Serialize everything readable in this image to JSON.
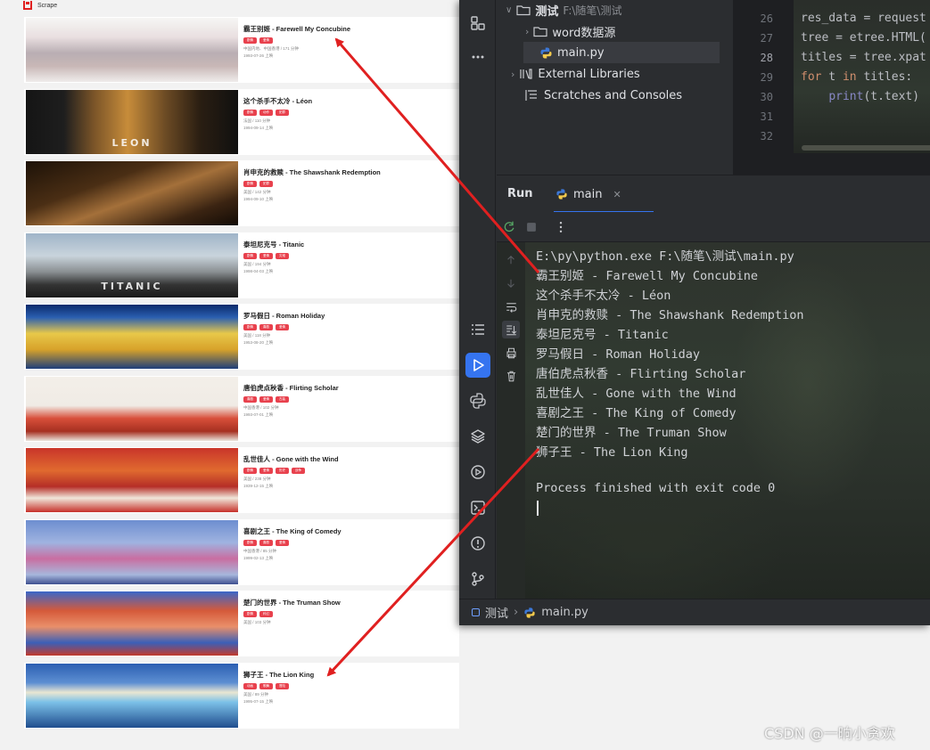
{
  "site": {
    "brand": "Scrape"
  },
  "movies": [
    {
      "title": "霸王别姬 - Farewell My Concubine",
      "poster_text": "",
      "tags": [
        "剧情",
        "爱情"
      ],
      "meta": "中国内地、中国香港 / 171 分钟",
      "date": "1993-07-26 上映",
      "poster_icon": "poster-farewell-my-concubine"
    },
    {
      "title": "这个杀手不太冷 - Léon",
      "poster_text": "LEON",
      "tags": [
        "剧情",
        "动作",
        "犯罪"
      ],
      "meta": "法国 / 110 分钟",
      "date": "1994-09-14 上映",
      "poster_icon": "poster-leon"
    },
    {
      "title": "肖申克的救赎 - The Shawshank Redemption",
      "poster_text": "",
      "tags": [
        "剧情",
        "犯罪"
      ],
      "meta": "美国 / 142 分钟",
      "date": "1994-09-10 上映",
      "poster_icon": "poster-shawshank"
    },
    {
      "title": "泰坦尼克号 - Titanic",
      "poster_text": "TITANIC",
      "tags": [
        "剧情",
        "爱情",
        "灾难"
      ],
      "meta": "美国 / 194 分钟",
      "date": "1998-04-03 上映",
      "poster_icon": "poster-titanic"
    },
    {
      "title": "罗马假日 - Roman Holiday",
      "poster_text": "",
      "tags": [
        "剧情",
        "喜剧",
        "爱情"
      ],
      "meta": "美国 / 118 分钟",
      "date": "1953-08-20 上映",
      "poster_icon": "poster-roman-holiday"
    },
    {
      "title": "唐伯虎点秋香 - Flirting Scholar",
      "poster_text": "",
      "tags": [
        "喜剧",
        "爱情",
        "古装"
      ],
      "meta": "中国香港 / 102 分钟",
      "date": "1993-07-01 上映",
      "poster_icon": "poster-flirting-scholar"
    },
    {
      "title": "乱世佳人 - Gone with the Wind",
      "poster_text": "",
      "tags": [
        "剧情",
        "爱情",
        "历史",
        "战争"
      ],
      "meta": "美国 / 238 分钟",
      "date": "1939-12-15 上映",
      "poster_icon": "poster-gone-with-the-wind"
    },
    {
      "title": "喜剧之王 - The King of Comedy",
      "poster_text": "",
      "tags": [
        "剧情",
        "喜剧",
        "爱情"
      ],
      "meta": "中国香港 / 85 分钟",
      "date": "1999-02-13 上映",
      "poster_icon": "poster-king-of-comedy"
    },
    {
      "title": "楚门的世界 - The Truman Show",
      "poster_text": "",
      "tags": [
        "剧情",
        "科幻"
      ],
      "meta": "美国 / 103 分钟",
      "date": "",
      "poster_icon": "poster-truman-show"
    },
    {
      "title": "狮子王 - The Lion King",
      "poster_text": "",
      "tags": [
        "动画",
        "歌舞",
        "冒险"
      ],
      "meta": "美国 / 89 分钟",
      "date": "1995-07-15 上映",
      "poster_icon": "poster-lion-king"
    }
  ],
  "ide": {
    "project_tree": {
      "root_label": "测试",
      "root_path": "F:\\随笔\\测试",
      "folder_label": "word数据源",
      "file_label": "main.py",
      "external_libraries": "External Libraries",
      "scratches": "Scratches and Consoles"
    },
    "editor": {
      "line_numbers": [
        "26",
        "27",
        "28",
        "29",
        "30",
        "31",
        "32"
      ],
      "code_lines": [
        {
          "plain": "res_data = request"
        },
        {
          "plain": "tree = etree.HTML("
        },
        {
          "plain": "titles = tree.xpat"
        },
        {
          "kw": "for",
          "plain_after": " t ",
          "kw2": "in",
          "rest": " titles:"
        },
        {
          "indent": "    ",
          "fn": "print",
          "rest": "(t.text)"
        }
      ]
    },
    "run": {
      "title": "Run",
      "tab_label": "main",
      "console_lines": [
        "E:\\py\\python.exe F:\\随笔\\测试\\main.py",
        "霸王别姬 - Farewell My Concubine",
        "这个杀手不太冷 - Léon",
        "肖申克的救赎 - The Shawshank Redemption",
        "泰坦尼克号 - Titanic",
        "罗马假日 - Roman Holiday",
        "唐伯虎点秋香 - Flirting Scholar",
        "乱世佳人 - Gone with the Wind",
        "喜剧之王 - The King of Comedy",
        "楚门的世界 - The Truman Show",
        "狮子王 - The Lion King",
        "",
        "Process finished with exit code 0"
      ]
    },
    "statusbar": {
      "project": "测试",
      "file": "main.py"
    }
  },
  "annotation": {
    "arrow_color": "#e02020"
  },
  "watermark": "CSDN @一晌小贪欢"
}
